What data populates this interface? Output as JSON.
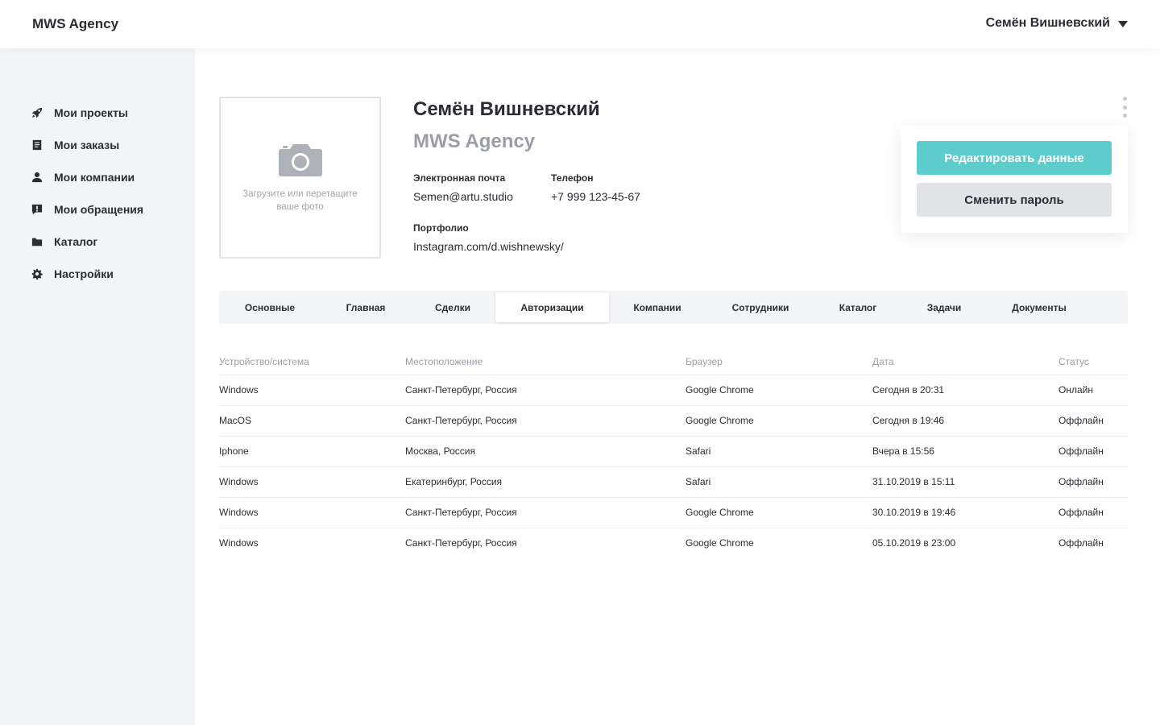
{
  "header": {
    "logo": "MWS Agency",
    "user_name": "Семён Вишневский"
  },
  "sidebar": {
    "items": [
      {
        "label": "Мои проекты",
        "icon": "rocket-icon"
      },
      {
        "label": "Мои заказы",
        "icon": "document-icon"
      },
      {
        "label": "Мои компании",
        "icon": "user-icon"
      },
      {
        "label": "Мои обращения",
        "icon": "message-alert-icon"
      },
      {
        "label": "Каталог",
        "icon": "folder-icon"
      },
      {
        "label": "Настройки",
        "icon": "gear-icon"
      }
    ]
  },
  "profile": {
    "photo_hint": "Загрузите или перетащите ваше фото",
    "name": "Семён Вишневский",
    "company": "MWS Agency",
    "email_label": "Электронная почта",
    "email": "Semen@artu.studio",
    "phone_label": "Телефон",
    "phone": "+7 999 123-45-67",
    "portfolio_label": "Портфолио",
    "portfolio": "Instagram.com/d.wishnewsky/"
  },
  "actions": {
    "edit_label": "Редактировать данные",
    "password_label": "Сменить пароль"
  },
  "tabs": [
    {
      "label": "Основные",
      "active": false
    },
    {
      "label": "Главная",
      "active": false
    },
    {
      "label": "Сделки",
      "active": false
    },
    {
      "label": "Авторизации",
      "active": true
    },
    {
      "label": "Компании",
      "active": false
    },
    {
      "label": "Сотрудники",
      "active": false
    },
    {
      "label": "Каталог",
      "active": false
    },
    {
      "label": "Задачи",
      "active": false
    },
    {
      "label": "Документы",
      "active": false
    }
  ],
  "table": {
    "headers": [
      "Устройство/система",
      "Местоположение",
      "Браузер",
      "Дата",
      "Статус"
    ],
    "rows": [
      [
        "Windows",
        "Санкт-Петербург, Россия",
        "Google Chrome",
        "Сегодня в 20:31",
        "Онлайн"
      ],
      [
        "MacOS",
        "Санкт-Петербург, Россия",
        "Google Chrome",
        "Сегодня в 19:46",
        "Оффлайн"
      ],
      [
        "Iphone",
        "Москва, Россия",
        "Safari",
        "Вчера в 15:56",
        "Оффлайн"
      ],
      [
        "Windows",
        "Екатеринбург, Россия",
        "Safari",
        "31.10.2019 в 15:11",
        "Оффлайн"
      ],
      [
        "Windows",
        "Санкт-Петербург, Россия",
        "Google Chrome",
        "30.10.2019 в 19:46",
        "Оффлайн"
      ],
      [
        "Windows",
        "Санкт-Петербург, Россия",
        "Google Chrome",
        "05.10.2019 в 23:00",
        "Оффлайн"
      ]
    ]
  },
  "colors": {
    "accent": "#5ccdcc",
    "sidebar_bg": "#f4f5f7",
    "text": "#2b2d33",
    "muted": "#9b9ea5"
  }
}
